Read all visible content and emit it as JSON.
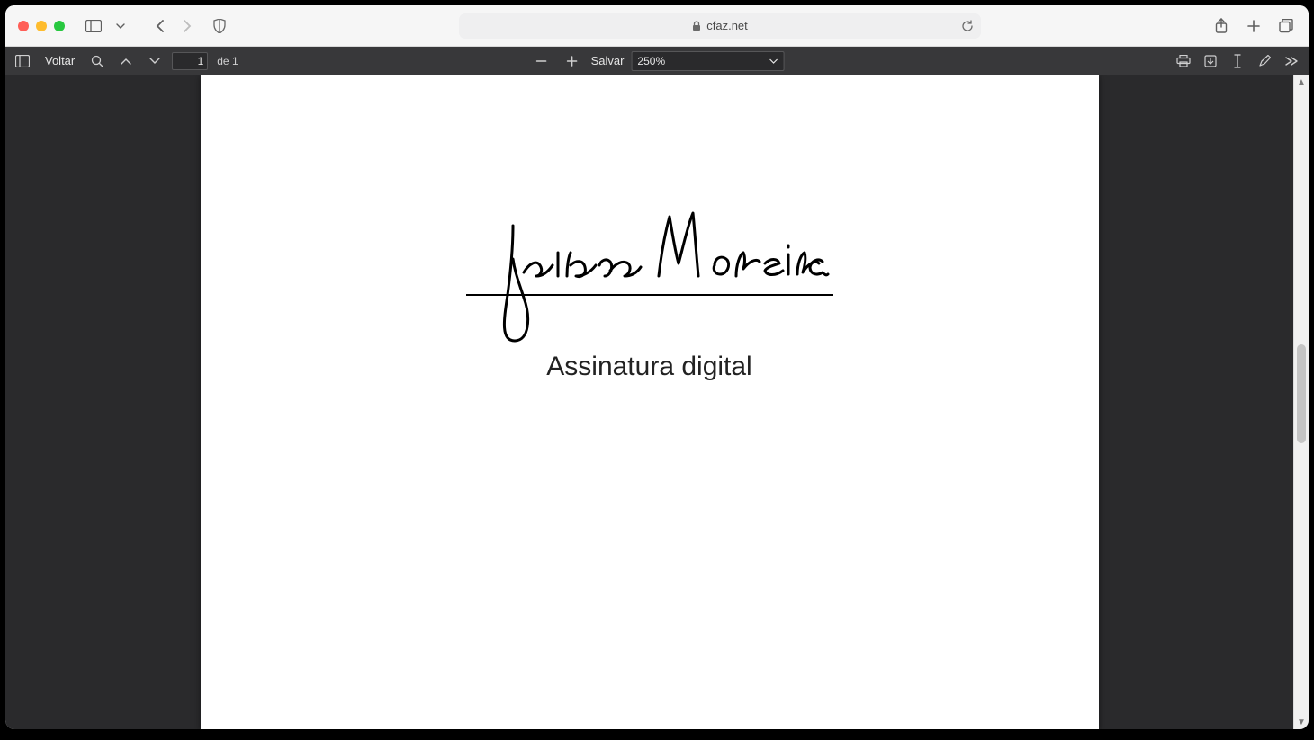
{
  "browser": {
    "address": "cfaz.net"
  },
  "pdf_toolbar": {
    "back_label": "Voltar",
    "page_current": "1",
    "page_total_prefix": "de",
    "page_total": "1",
    "save_label": "Salvar",
    "zoom_value": "250%"
  },
  "document": {
    "signature_name": "Juliana Moreira",
    "caption": "Assinatura digital"
  }
}
